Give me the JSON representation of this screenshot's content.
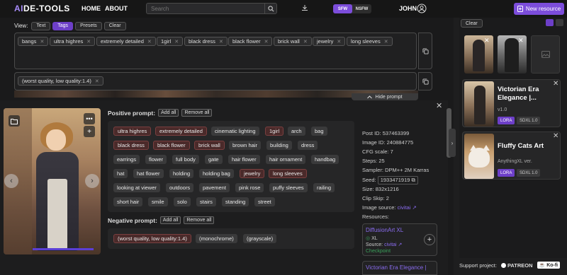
{
  "header": {
    "logo_prefix": "AI",
    "logo_rest": "DE-TOOLS",
    "nav": [
      "HOME",
      "ABOUT"
    ],
    "search_placeholder": "Search",
    "sfw": "SFW",
    "nsfw": "NSFW",
    "user": "JOHN",
    "new_resource": "New resource"
  },
  "view": {
    "label": "View:",
    "options": [
      "Text",
      "Tags",
      "Presets",
      "Clear"
    ],
    "selected": "Tags"
  },
  "top_tags": [
    "bangs",
    "ultra highres",
    "extremely detailed",
    "1girl",
    "black dress",
    "black flower",
    "brick wall",
    "jewelry",
    "long sleeves"
  ],
  "negative_top_tags": [
    "(worst quality, low quality:1.4)"
  ],
  "hide_prompt": "Hide prompt",
  "positive": {
    "title": "Positive prompt:",
    "add_all": "Add all",
    "remove_all": "Remove all",
    "tags": [
      "ultra highres",
      "extremely detailed",
      "cinematic lighting",
      "1girl",
      "arch",
      "bag",
      "black dress",
      "black flower",
      "brick wall",
      "brown hair",
      "building",
      "dress",
      "earrings",
      "flower",
      "full body",
      "gate",
      "hair flower",
      "hair ornament",
      "handbag",
      "hat",
      "hat flower",
      "holding",
      "holding bag",
      "jewelry",
      "long sleeves",
      "looking at viewer",
      "outdoors",
      "pavement",
      "pink rose",
      "puffy sleeves",
      "railing",
      "short hair",
      "smile",
      "solo",
      "stairs",
      "standing",
      "street"
    ],
    "highlighted": [
      "ultra highres",
      "extremely detailed",
      "1girl",
      "black dress",
      "black flower",
      "brick wall",
      "jewelry",
      "long sleeves"
    ]
  },
  "negative": {
    "title": "Negative prompt:",
    "add_all": "Add all",
    "remove_all": "Remove all",
    "tags": [
      "(worst quality, low quality:1.4)",
      "(monochrome)",
      "(grayscale)"
    ],
    "highlighted": [
      "(worst quality, low quality:1.4)"
    ]
  },
  "meta": {
    "post_id": "Post ID: 537463399",
    "image_id": "Image ID: 240884775",
    "cfg": "CFG scale: 7",
    "steps": "Steps: 25",
    "sampler": "Sampler: DPM++ 2M Karras",
    "seed_label": "Seed:",
    "seed": "1933471919",
    "size": "Size: 832x1216",
    "clip": "Clip Skip: 2",
    "source_label": "Image source:",
    "source": "civitai",
    "resources_label": "Resources:"
  },
  "resource_card": {
    "name": "DiffusionArt XL",
    "version": "XL",
    "source_label": "Source:",
    "source": "civitai",
    "type": "Checkpoint"
  },
  "resource_card2": "Victorian Era Elegance |",
  "right": {
    "clear": "Clear",
    "cards": [
      {
        "title": "Victorian Era Elegance |...",
        "version": "v1.0",
        "type": "LORA",
        "base": "SDXL 1.0"
      },
      {
        "title": "Fluffy Cats Art",
        "version": "AnythingXL ver.",
        "type": "LORA",
        "base": "SDXL 1.0"
      }
    ]
  },
  "footer": {
    "support": "Support project:",
    "patreon": "PATREON",
    "kofi": "Ko-fi"
  },
  "progress": 1.0,
  "colors": {
    "accent": "#7c4ddb",
    "tag_highlight": "#4a2a2a"
  }
}
